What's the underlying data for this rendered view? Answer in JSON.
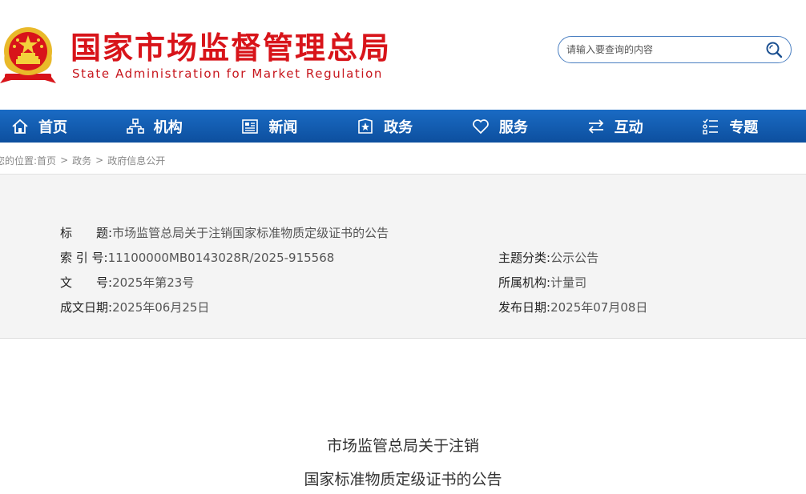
{
  "header": {
    "brand_cn": "国家市场监督管理总局",
    "brand_en": "State Administration for Market Regulation",
    "search_placeholder": "请输入要查询的内容"
  },
  "nav": {
    "items": [
      {
        "label": "首页",
        "icon": "home-icon"
      },
      {
        "label": "机构",
        "icon": "org-chart-icon"
      },
      {
        "label": "新闻",
        "icon": "newspaper-icon"
      },
      {
        "label": "政务",
        "icon": "shield-icon"
      },
      {
        "label": "服务",
        "icon": "heart-icon"
      },
      {
        "label": "互动",
        "icon": "exchange-icon"
      },
      {
        "label": "专题",
        "icon": "list-icon"
      }
    ]
  },
  "breadcrumb": {
    "prefix": "您的位置:",
    "items": [
      "首页",
      "政务",
      "政府信息公开"
    ],
    "separator": ">"
  },
  "meta": {
    "title_label": "标　　题:",
    "title_value": "市场监管总局关于注销国家标准物质定级证书的公告",
    "index_label": "索 引 号:",
    "index_value": "11100000MB0143028R/2025-915568",
    "doc_label": "文　　号:",
    "doc_value": "2025年第23号",
    "date_label": "成文日期:",
    "date_value": "2025年06月25日",
    "category_label": "主题分类:",
    "category_value": "公示公告",
    "agency_label": "所属机构:",
    "agency_value": "计量司",
    "publish_label": "发布日期:",
    "publish_value": "2025年07月08日"
  },
  "article": {
    "title_line1": "市场监管总局关于注销",
    "title_line2": "国家标准物质定级证书的公告"
  },
  "colors": {
    "brand_red": "#d8141a",
    "nav_blue": "#0d4f9e",
    "search_border": "#4a7fc1"
  }
}
